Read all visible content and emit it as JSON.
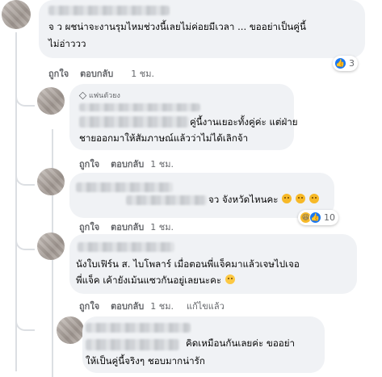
{
  "comments": [
    {
      "id": "c1",
      "author": "",
      "line1": "จ ว ผชน่าจะงานรุมไหมช่วงนี้เลยไม่ค่อยมีเวลา ... ขออย่าเป็นคู่นี้",
      "line2": "ไม่อ่าววว",
      "reaction_count": "3",
      "actions": {
        "like": "ถูกใจ",
        "reply": "ตอบกลับ",
        "time": "1 ชม."
      }
    },
    {
      "id": "c2",
      "badge": "แฟนตัวยง",
      "line1": "คู่นี้งานเยอะทั้งคู่ค่ะ แต่ฝ่าย",
      "line2": "ชายออกมาให้สัมภาษณ์แล้วว่าไม่ได้เลิกจ้า",
      "actions": {
        "like": "ถูกใจ",
        "reply": "ตอบกลับ",
        "time": "1 ชม."
      }
    },
    {
      "id": "c3",
      "line1": "จว จังหวัดไหนคะ",
      "reaction_count": "10",
      "actions": {
        "like": "ถูกใจ",
        "reply": "ตอบกลับ",
        "time": "1 ชม."
      }
    },
    {
      "id": "c4",
      "line1": "นังใบเฟิร์น ส. ไบโพลาร์ เมื่อตอนพี่แจ็คมาแล้วเจษไปเจอ",
      "line2": "พี่แจ็ค เค้ายังเม้นแซวกันอยู่เลยนะคะ",
      "actions": {
        "like": "ถูกใจ",
        "reply": "ตอบกลับ",
        "time": "1 ชม.",
        "edited": "แก้ไขแล้ว"
      }
    },
    {
      "id": "c5",
      "line1": "คิดเหมือนกันเลยค่ะ ขออย่า",
      "line2": "ให้เป็นคู่นี้จริงๆ ชอบมากน่ารัก"
    }
  ],
  "colors": {
    "bubble": "#f0f2f5",
    "meta": "#65676b",
    "like": "#1877f2",
    "haha": "#f7b928"
  }
}
